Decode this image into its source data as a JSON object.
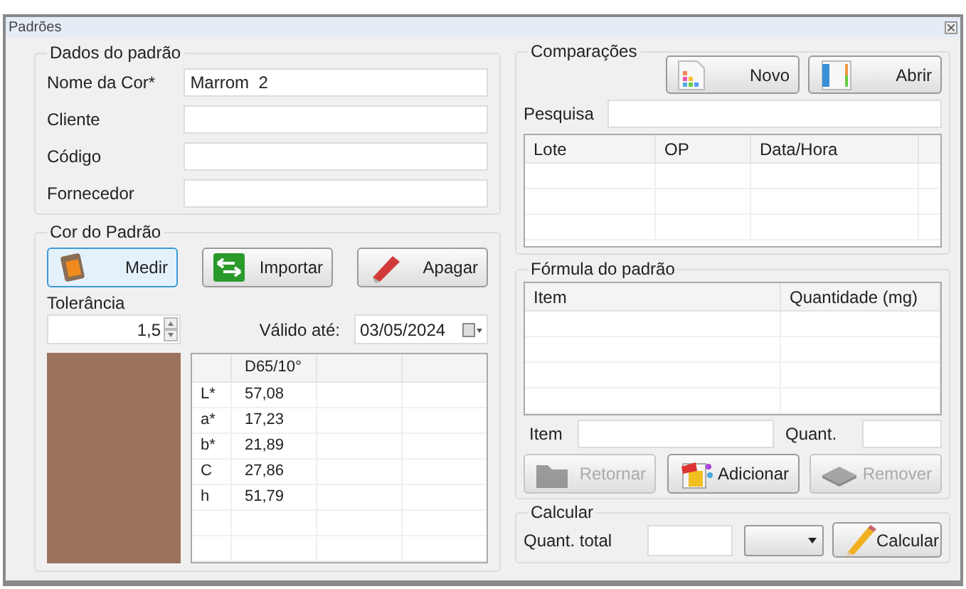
{
  "window": {
    "title": "Padrões"
  },
  "dados_do_padrao": {
    "title": "Dados do padrão",
    "fields": [
      {
        "label": "Nome da Cor*",
        "value": "Marrom  2"
      },
      {
        "label": "Cliente"
      },
      {
        "label": "Código"
      },
      {
        "label": "Fornecedor"
      }
    ]
  },
  "cor_do_padrao": {
    "title": "Cor do Padrão",
    "buttons": [
      {
        "label": "Medir",
        "kind": "measure",
        "selected": true
      },
      {
        "label": "Importar",
        "kind": "import",
        "selected": false
      },
      {
        "label": "Apagar",
        "kind": "erase",
        "selected": false
      }
    ],
    "tolerancia": {
      "label": "Tolerância",
      "value": "1,5"
    },
    "validade": {
      "label": "Válido até:",
      "value": "03/05/2024"
    },
    "swatch": {
      "color": "#9b735d"
    },
    "table": {
      "columns": [
        "D65/10°"
      ],
      "rows": [
        {
          "label": "L*",
          "value": "57,08"
        },
        {
          "label": "a*",
          "value": "17,23"
        },
        {
          "label": "b*",
          "value": "21,89"
        },
        {
          "label": "C",
          "value": "27,86"
        },
        {
          "label": "h",
          "value": "51,79"
        }
      ]
    }
  },
  "comparacoes": {
    "title": "Comparações",
    "buttons": [
      {
        "label": "Novo",
        "kind": "new"
      },
      {
        "label": "Abrir",
        "kind": "open"
      }
    ],
    "search": {
      "label": "Pesquisa"
    },
    "table": {
      "columns": [
        "Lote",
        "OP",
        "Data/Hora"
      ]
    }
  },
  "formula": {
    "title": "Fórmula do padrão",
    "table": {
      "columns": [
        "Item",
        "Quantidade (mg)"
      ]
    },
    "item_label": "Item",
    "quant_label": "Quant.",
    "buttons": [
      {
        "label": "Retornar",
        "kind": "back",
        "disabled": true
      },
      {
        "label": "Adicionar",
        "kind": "add",
        "disabled": false
      },
      {
        "label": "Remover",
        "kind": "remove",
        "disabled": true
      }
    ]
  },
  "calcular": {
    "title": "Calcular",
    "label": "Quant. total",
    "button": {
      "label": "Calcular"
    }
  }
}
